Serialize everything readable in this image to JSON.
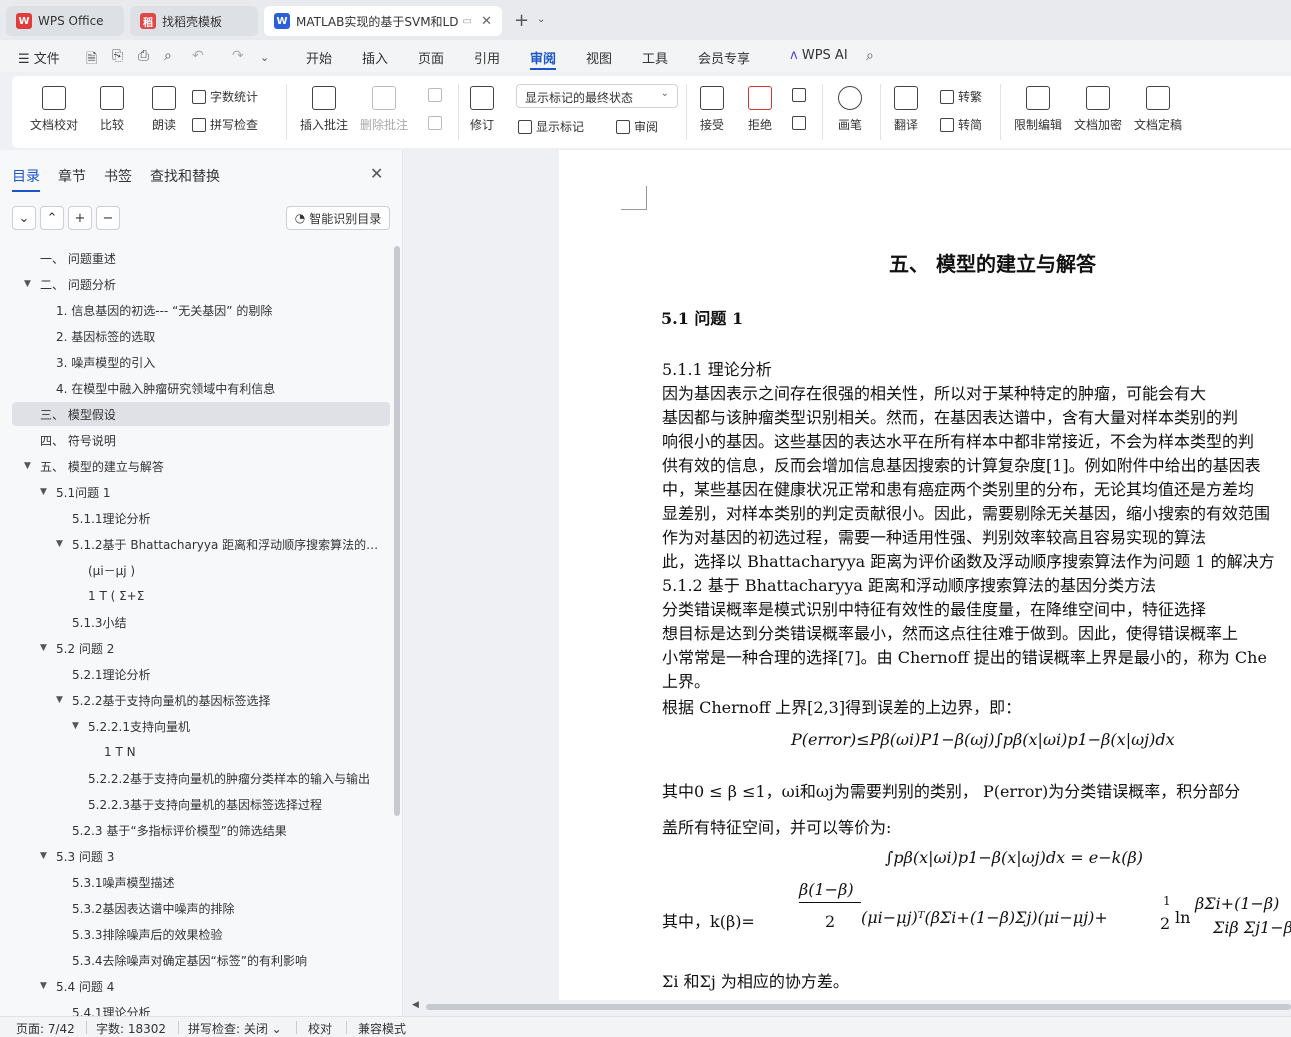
{
  "tabs": [
    {
      "label": "WPS Office",
      "logo": "W"
    },
    {
      "label": "找稻壳模板",
      "logo": "稻"
    },
    {
      "label": "MATLAB实现的基于SVM和LD",
      "logo": "W"
    }
  ],
  "menu": {
    "file": "文件",
    "items": [
      "开始",
      "插入",
      "页面",
      "引用",
      "审阅",
      "视图",
      "工具",
      "会员专享"
    ],
    "active": "审阅",
    "ai": "WPS AI"
  },
  "ribbon": {
    "proofread": "文档校对",
    "compare": "比较",
    "read_aloud": "朗读",
    "word_count": "字数统计",
    "spell_check": "拼写检查",
    "insert_comment": "插入批注",
    "delete_comment": "删除批注",
    "revise": "修订",
    "markup_state": "显示标记的最终状态",
    "show_markup": "显示标记",
    "review": "审阅",
    "accept": "接受",
    "reject": "拒绝",
    "pen": "画笔",
    "translate": "翻译",
    "to_traditional": "转繁",
    "to_simplified": "转简",
    "restrict_edit": "限制编辑",
    "doc_encrypt": "文档加密",
    "doc_finalize": "文档定稿"
  },
  "left_panel": {
    "tabs": [
      "目录",
      "章节",
      "书签",
      "查找和替换"
    ],
    "active_tab": "目录",
    "smart_toc": "智能识别目录",
    "toc": [
      {
        "text": "一、 问题重述",
        "level": 0,
        "caret": false
      },
      {
        "text": "二、 问题分析",
        "level": 0,
        "caret": true
      },
      {
        "text": "1.  信息基因的初选--- “无关基因” 的剔除",
        "level": 1,
        "caret": false
      },
      {
        "text": "2.  基因标签的选取",
        "level": 1,
        "caret": false
      },
      {
        "text": "3.  噪声模型的引入",
        "level": 1,
        "caret": false
      },
      {
        "text": "4.  在模型中融入肿瘤研究领域中有利信息",
        "level": 1,
        "caret": false
      },
      {
        "text": "三、 模型假设",
        "level": 0,
        "caret": false,
        "selected": true
      },
      {
        "text": "四、 符号说明",
        "level": 0,
        "caret": false
      },
      {
        "text": "五、 模型的建立与解答",
        "level": 0,
        "caret": true
      },
      {
        "text": "5.1问题 1",
        "level": 1,
        "caret": true
      },
      {
        "text": "5.1.1理论分析",
        "level": 2,
        "caret": false
      },
      {
        "text": "5.1.2基于 Bhattacharyya 距离和浮动顺序搜索算法的基 ...",
        "level": 2,
        "caret": true
      },
      {
        "text": "(μi－μj )",
        "level": 3,
        "caret": false
      },
      {
        "text": "1 T ( Σ+Σ",
        "level": 3,
        "caret": false
      },
      {
        "text": "5.1.3小结",
        "level": 2,
        "caret": false
      },
      {
        "text": "5.2 问题 2",
        "level": 1,
        "caret": true
      },
      {
        "text": "5.2.1理论分析",
        "level": 2,
        "caret": false
      },
      {
        "text": "5.2.2基于支持向量机的基因标签选择",
        "level": 2,
        "caret": true
      },
      {
        "text": "5.2.2.1支持向量机",
        "level": 3,
        "caret": true
      },
      {
        "text": "1  T  N",
        "level": 4,
        "caret": false
      },
      {
        "text": "5.2.2.2基于支持向量机的肿瘤分类样本的输入与输出",
        "level": 3,
        "caret": false
      },
      {
        "text": "5.2.2.3基于支持向量机的基因标签选择过程",
        "level": 3,
        "caret": false
      },
      {
        "text": "5.2.3 基于“多指标评价模型”的筛选结果",
        "level": 2,
        "caret": false
      },
      {
        "text": "5.3 问题 3",
        "level": 1,
        "caret": true
      },
      {
        "text": "5.3.1噪声模型描述",
        "level": 2,
        "caret": false
      },
      {
        "text": "5.3.2基因表达谱中噪声的排除",
        "level": 2,
        "caret": false
      },
      {
        "text": "5.3.3排除噪声后的效果检验",
        "level": 2,
        "caret": false
      },
      {
        "text": "5.3.4去除噪声对确定基因“标签”的有利影响",
        "level": 2,
        "caret": false
      },
      {
        "text": "5.4 问题 4",
        "level": 1,
        "caret": true
      },
      {
        "text": "5.4.1理论分析",
        "level": 2,
        "caret": false
      }
    ]
  },
  "document": {
    "heading": "五、 模型的建立与解答",
    "section": "5.1   问题 1",
    "lines": [
      "5.1.1  理论分析",
      "    因为基因表示之间存在很强的相关性，所以对于某种特定的肿瘤，可能会有大",
      "基因都与该肿瘤类型识别相关。然而，在基因表达谱中，含有大量对样本类别的判",
      "响很小的基因。这些基因的表达水平在所有样本中都非常接近，不会为样本类型的判",
      "供有效的信息，反而会增加信息基因搜索的计算复杂度[1]。例如附件中给出的基因表",
      "中，某些基因在健康状况正常和患有癌症两个类别里的分布，无论其均值还是方差均",
      "显差别，对样本类别的判定贡献很小。因此，需要剔除无关基因，缩小搜索的有效范围",
      "    作为对基因的初选过程，需要一种适用性强、判别效率较高且容易实现的算法",
      "此，选择以  Bhattacharyya 距离为评价函数及浮动顺序搜索算法作为问题  1 的解决方",
      "5.1.2  基于  Bhattacharyya 距离和浮动顺序搜索算法的基因分类方法",
      "     分类错误概率是模式识别中特征有效性的最佳度量，在降维空间中，特征选择",
      "想目标是达到分类错误概率最小，然而这点往往难于做到。因此，使得错误概率上",
      "小常常是一种合理的选择[7]。由 Chernoff 提出的错误概率上界是最小的，称为  Che",
      "上界。",
      "     根据  Chernoff 上界[2,3]得到误差的上边界，即："
    ],
    "formula1": "P(error)≤Pβ(ωi)P1−β(ωj)∫pβ(x|ωi)p1−β(x|ωj)dx",
    "line_after_f1": "    其中0 ≤ β ≤1，ωi和ωj为需要判别的类别，  P(error)为分类错误概率，积分部分",
    "line_cover": "盖所有特征空间，并可以等价为:",
    "formula2": "∫pβ(x|ωi)p1−β(x|ωj)dx = e−k(β)",
    "formula3_prefix": "其中，k(β)=",
    "formula3_num": "β(1−β)",
    "formula3_den": "2",
    "formula3_body": "(μi−μj)ᵀ(βΣi+(1−β)Σj)(μi−μj)+",
    "formula3_half": "1",
    "formula3_half_den": "2",
    "formula3_ln": "ln",
    "formula3_ln_num": "βΣi+(1−β)",
    "formula3_ln_den": "Σiβ Σj1−β",
    "last_line": "Σi 和Σj 为相应的协方差。"
  },
  "status": {
    "page": "页面: 7/42",
    "words": "字数: 18302",
    "spell": "拼写检查: 关闭",
    "proof": "校对",
    "compat": "兼容模式"
  }
}
